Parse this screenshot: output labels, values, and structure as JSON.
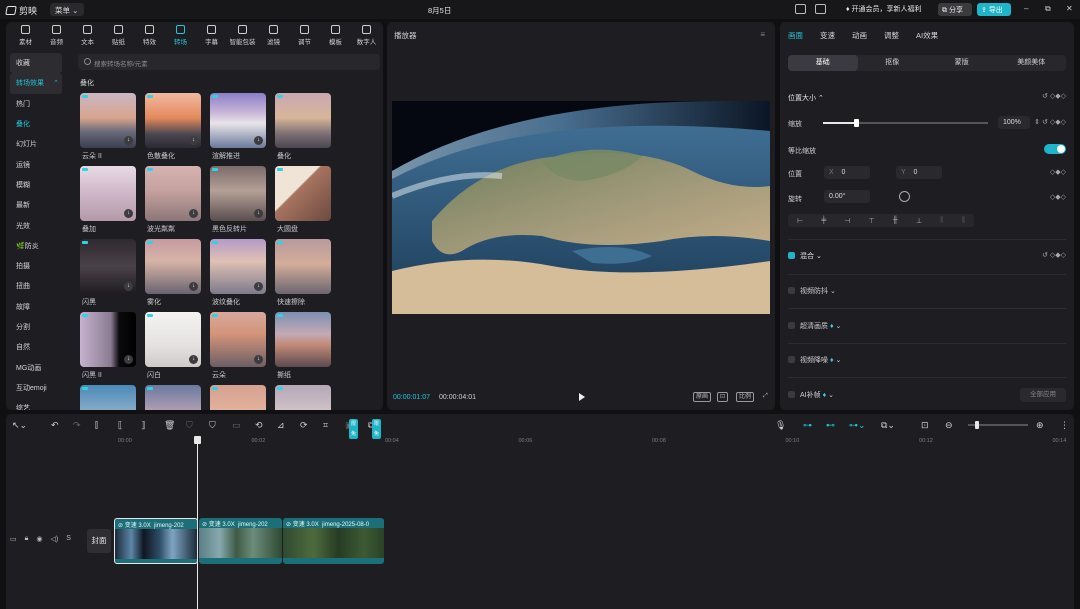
{
  "titlebar": {
    "app_name": "剪映",
    "menu_label": "菜单",
    "date": "8月5日",
    "vip_text": "开通会员，享新人福利",
    "share_label": "分享",
    "export_label": "导出"
  },
  "media_tabs": [
    {
      "label": "素材",
      "icon": "media-icon"
    },
    {
      "label": "音频",
      "icon": "audio-icon"
    },
    {
      "label": "文本",
      "icon": "text-icon"
    },
    {
      "label": "贴纸",
      "icon": "sticker-icon"
    },
    {
      "label": "特效",
      "icon": "effects-icon"
    },
    {
      "label": "转场",
      "icon": "transition-icon"
    },
    {
      "label": "字幕",
      "icon": "subtitle-icon"
    },
    {
      "label": "智能包装",
      "icon": "smart-package-icon"
    },
    {
      "label": "滤镜",
      "icon": "filter-icon"
    },
    {
      "label": "调节",
      "icon": "adjust-icon"
    },
    {
      "label": "模板",
      "icon": "template-icon"
    },
    {
      "label": "数字人",
      "icon": "digital-human-icon"
    }
  ],
  "sidebar": {
    "items": [
      "收藏",
      "转场效果",
      "热门",
      "叠化",
      "幻灯片",
      "运镜",
      "模糊",
      "最新",
      "光效",
      "🌿防炎",
      "拍摄",
      "扭曲",
      "故障",
      "分割",
      "自然",
      "MG动画",
      "互动emoji",
      "综艺"
    ]
  },
  "search": {
    "placeholder": "搜索转场名称/元素"
  },
  "section_title": "叠化",
  "effects": [
    {
      "label": "云朵 II"
    },
    {
      "label": "色散叠化"
    },
    {
      "label": "渲解推进"
    },
    {
      "label": "叠化"
    },
    {
      "label": "叠加"
    },
    {
      "label": "波光粼粼"
    },
    {
      "label": "黑色反转片"
    },
    {
      "label": "大圆盘"
    },
    {
      "label": "闪黑"
    },
    {
      "label": "雾化"
    },
    {
      "label": "波纹叠化"
    },
    {
      "label": "快速擦除"
    },
    {
      "label": "闪黑 II"
    },
    {
      "label": "闪白"
    },
    {
      "label": "云朵"
    },
    {
      "label": "撕纸"
    },
    {
      "label": ""
    },
    {
      "label": ""
    },
    {
      "label": ""
    },
    {
      "label": ""
    }
  ],
  "player": {
    "title": "播放器",
    "current_time": "00:00:01:07",
    "total_time": "00:00:04:01",
    "btn_original": "原画",
    "btn_ratio": "比例"
  },
  "props": {
    "tabs": [
      "画面",
      "变速",
      "动画",
      "调整",
      "AI效果"
    ],
    "subtabs": [
      "基础",
      "抠像",
      "蒙版",
      "美颜美体"
    ],
    "pos_size": "位置大小",
    "scale_label": "缩放",
    "scale_value": "100%",
    "uniform_label": "等比缩放",
    "position_label": "位置",
    "x_label": "X",
    "x_value": "0",
    "y_label": "Y",
    "y_value": "0",
    "rotate_label": "旋转",
    "rotate_value": "0.00°",
    "blend_label": "混合",
    "stabilize_label": "视频防抖",
    "hd_label": "超清画质",
    "denoise_label": "视频降噪",
    "ai_label": "AI补帧",
    "apply_all": "全部应用"
  },
  "timeline": {
    "ruler": [
      "00:00",
      "00:02",
      "00:04",
      "00:06",
      "00:08",
      "00:10",
      "00:12",
      "00:14"
    ],
    "cover_label": "封面",
    "mini_badge": "限免",
    "clips": [
      {
        "speed": "变速 3.0X",
        "name": "jimeng-202"
      },
      {
        "speed": "变速 3.0X",
        "name": "jimeng-202"
      },
      {
        "speed": "变速 3.0X",
        "name": "jimeng-2025-08-0"
      }
    ]
  },
  "colors": {
    "accent": "#22c4d8",
    "panel": "#1e1e22",
    "background": "#101013",
    "clip": "#1a6f78"
  }
}
